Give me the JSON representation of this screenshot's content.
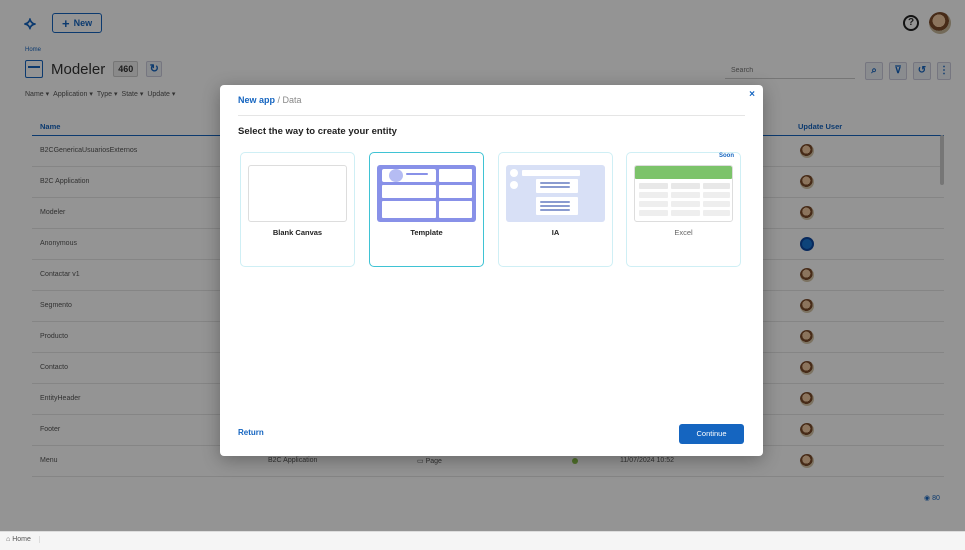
{
  "header": {
    "new_label": "New"
  },
  "breadcrumb": "Home",
  "page": {
    "title": "Modeler",
    "count": "460"
  },
  "filters": [
    "Name",
    "Application",
    "Type",
    "State",
    "Update"
  ],
  "search": {
    "placeholder": "Search"
  },
  "table": {
    "columns": {
      "name": "Name",
      "update_user": "Update User"
    },
    "rows": [
      {
        "name": "B2CGenericaUsuariosExternos"
      },
      {
        "name": "B2C Application"
      },
      {
        "name": "Modeler"
      },
      {
        "name": "Anonymous"
      },
      {
        "name": "Contactar v1"
      },
      {
        "name": "Segmento"
      },
      {
        "name": "Producto"
      },
      {
        "name": "Contacto"
      },
      {
        "name": "EntityHeader"
      },
      {
        "name": "Footer"
      },
      {
        "name": "Menu",
        "application": "B2C Application",
        "type": "Page",
        "date": "11/07/2024 10:52"
      }
    ]
  },
  "views_count": "80",
  "bottom_tab": {
    "home": "Home"
  },
  "modal": {
    "title_main": "New app",
    "title_sub": "/ Data",
    "close": "×",
    "question": "Select the way to create your entity",
    "options": [
      {
        "label": "Blank Canvas"
      },
      {
        "label": "Template"
      },
      {
        "label": "IA"
      },
      {
        "label": "Excel",
        "badge": "Soon"
      }
    ],
    "return_label": "Return",
    "continue_label": "Continue"
  },
  "colors": {
    "accent": "#1565c0",
    "selected_border": "#3fc3d4",
    "state_active": "#8bc34a"
  },
  "icons": [
    "app-logo-icon",
    "plus-icon",
    "help-icon",
    "modeler-icon",
    "refresh-icon",
    "search-icon",
    "filter-icon",
    "history-icon",
    "more-icon",
    "close-icon",
    "eye-icon",
    "home-icon"
  ]
}
